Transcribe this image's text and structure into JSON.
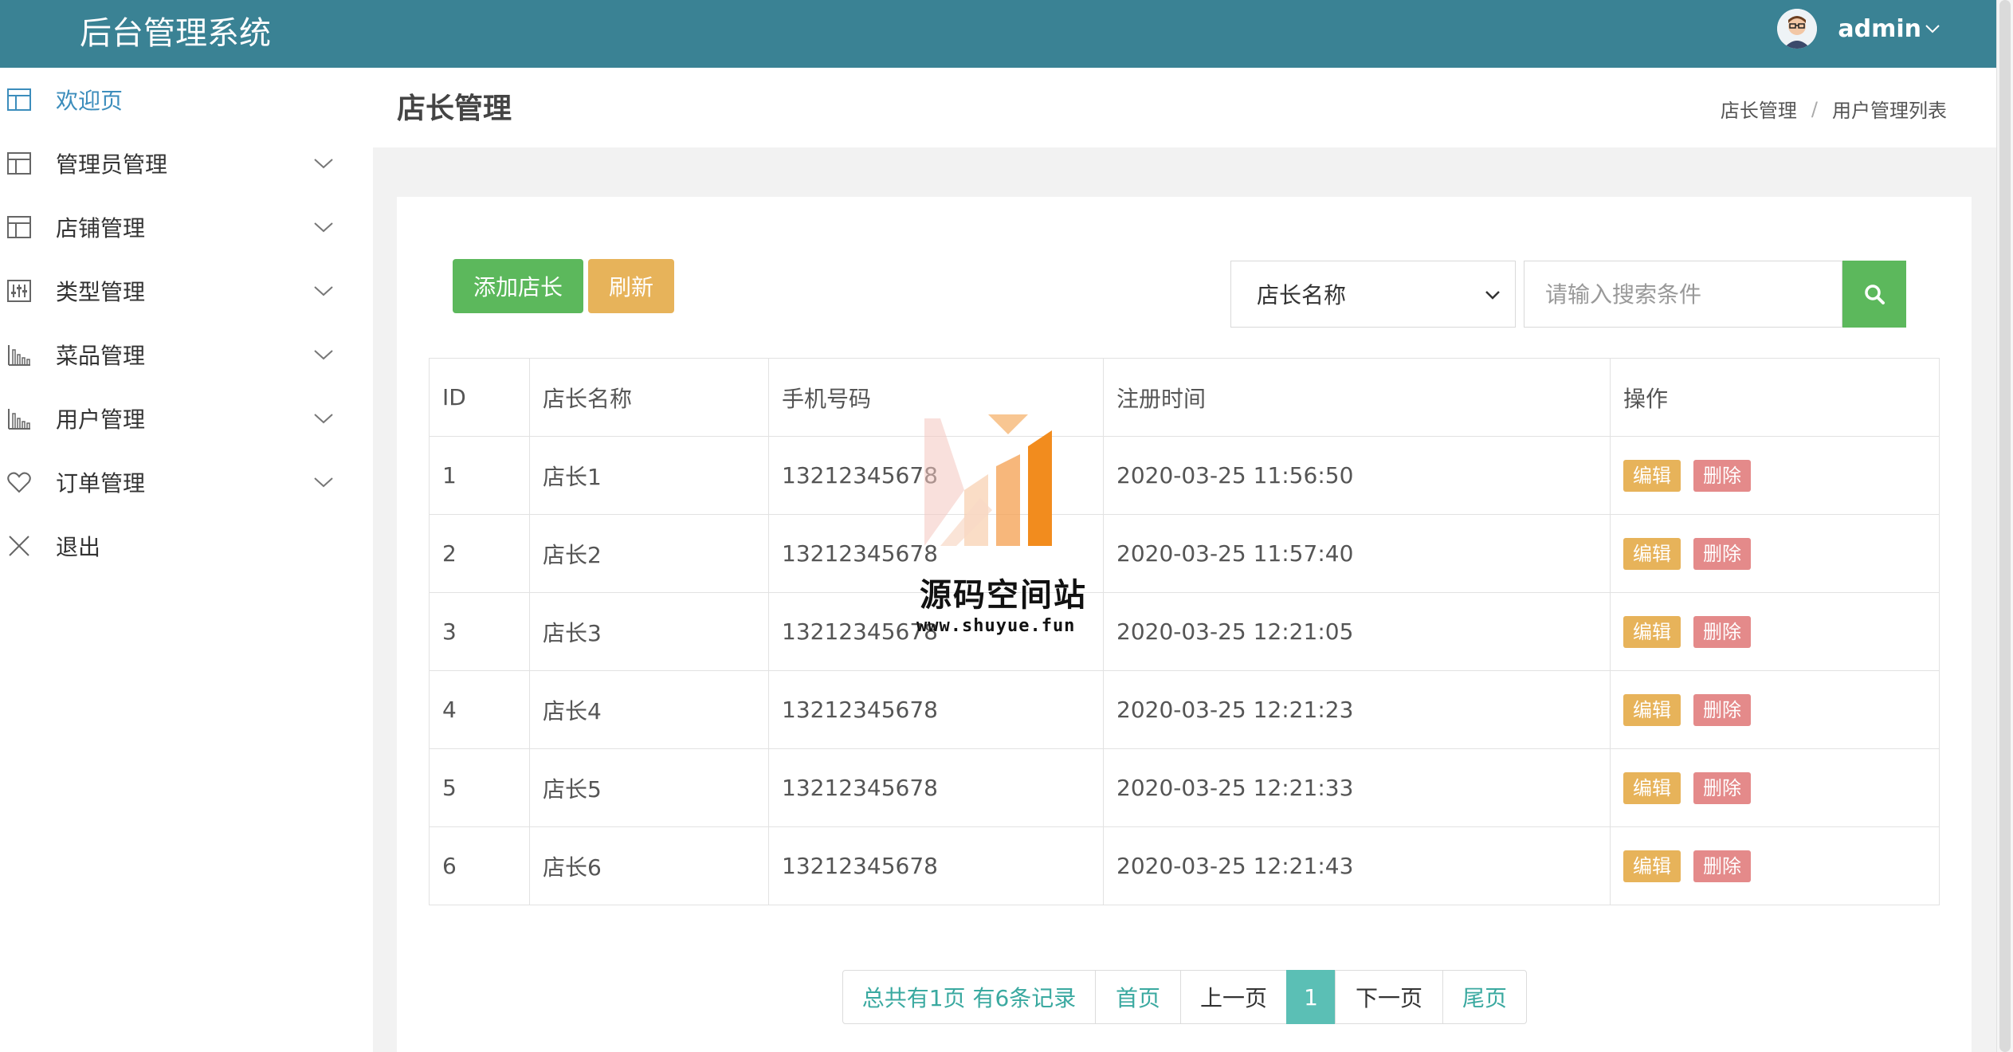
{
  "header": {
    "title": "后台管理系统",
    "user_name": "admin"
  },
  "sidebar": {
    "items": [
      {
        "label": "欢迎页",
        "icon": "layout-icon",
        "active": true
      },
      {
        "label": "管理员管理",
        "icon": "layout-icon"
      },
      {
        "label": "店铺管理",
        "icon": "layout-icon"
      },
      {
        "label": "类型管理",
        "icon": "sliders-icon"
      },
      {
        "label": "菜品管理",
        "icon": "bar-chart-icon"
      },
      {
        "label": "用户管理",
        "icon": "bar-chart-icon"
      },
      {
        "label": "订单管理",
        "icon": "heart-icon"
      },
      {
        "label": "退出",
        "icon": "close-icon"
      }
    ]
  },
  "page": {
    "title": "店长管理",
    "breadcrumb": [
      "店长管理",
      "用户管理列表"
    ],
    "breadcrumb_sep": "/"
  },
  "toolbar": {
    "add_label": "添加店长",
    "refresh_label": "刷新",
    "search_field": "店长名称",
    "search_placeholder": "请输入搜索条件"
  },
  "table": {
    "headers": [
      "ID",
      "店长名称",
      "手机号码",
      "注册时间",
      "操作"
    ],
    "rows": [
      {
        "id": "1",
        "name": "店长1",
        "phone": "13212345678",
        "time": "2020-03-25 11:56:50"
      },
      {
        "id": "2",
        "name": "店长2",
        "phone": "13212345678",
        "time": "2020-03-25 11:57:40"
      },
      {
        "id": "3",
        "name": "店长3",
        "phone": "13212345678",
        "time": "2020-03-25 12:21:05"
      },
      {
        "id": "4",
        "name": "店长4",
        "phone": "13212345678",
        "time": "2020-03-25 12:21:23"
      },
      {
        "id": "5",
        "name": "店长5",
        "phone": "13212345678",
        "time": "2020-03-25 12:21:33"
      },
      {
        "id": "6",
        "name": "店长6",
        "phone": "13212345678",
        "time": "2020-03-25 12:21:43"
      }
    ],
    "edit_label": "编辑",
    "delete_label": "删除"
  },
  "pagination": {
    "info": "总共有1页  有6条记录",
    "first": "首页",
    "prev": "上一页",
    "current": "1",
    "next": "下一页",
    "last": "尾页"
  },
  "watermark": {
    "title": "源码空间站",
    "url": "www.shuyue.fun"
  },
  "colors": {
    "header": "#3a8294",
    "primary": "#5cb85c",
    "warning": "#e7b35a",
    "danger": "#e48a8a",
    "active_link": "#3c8dbc",
    "page_active": "#5bbfb5"
  }
}
